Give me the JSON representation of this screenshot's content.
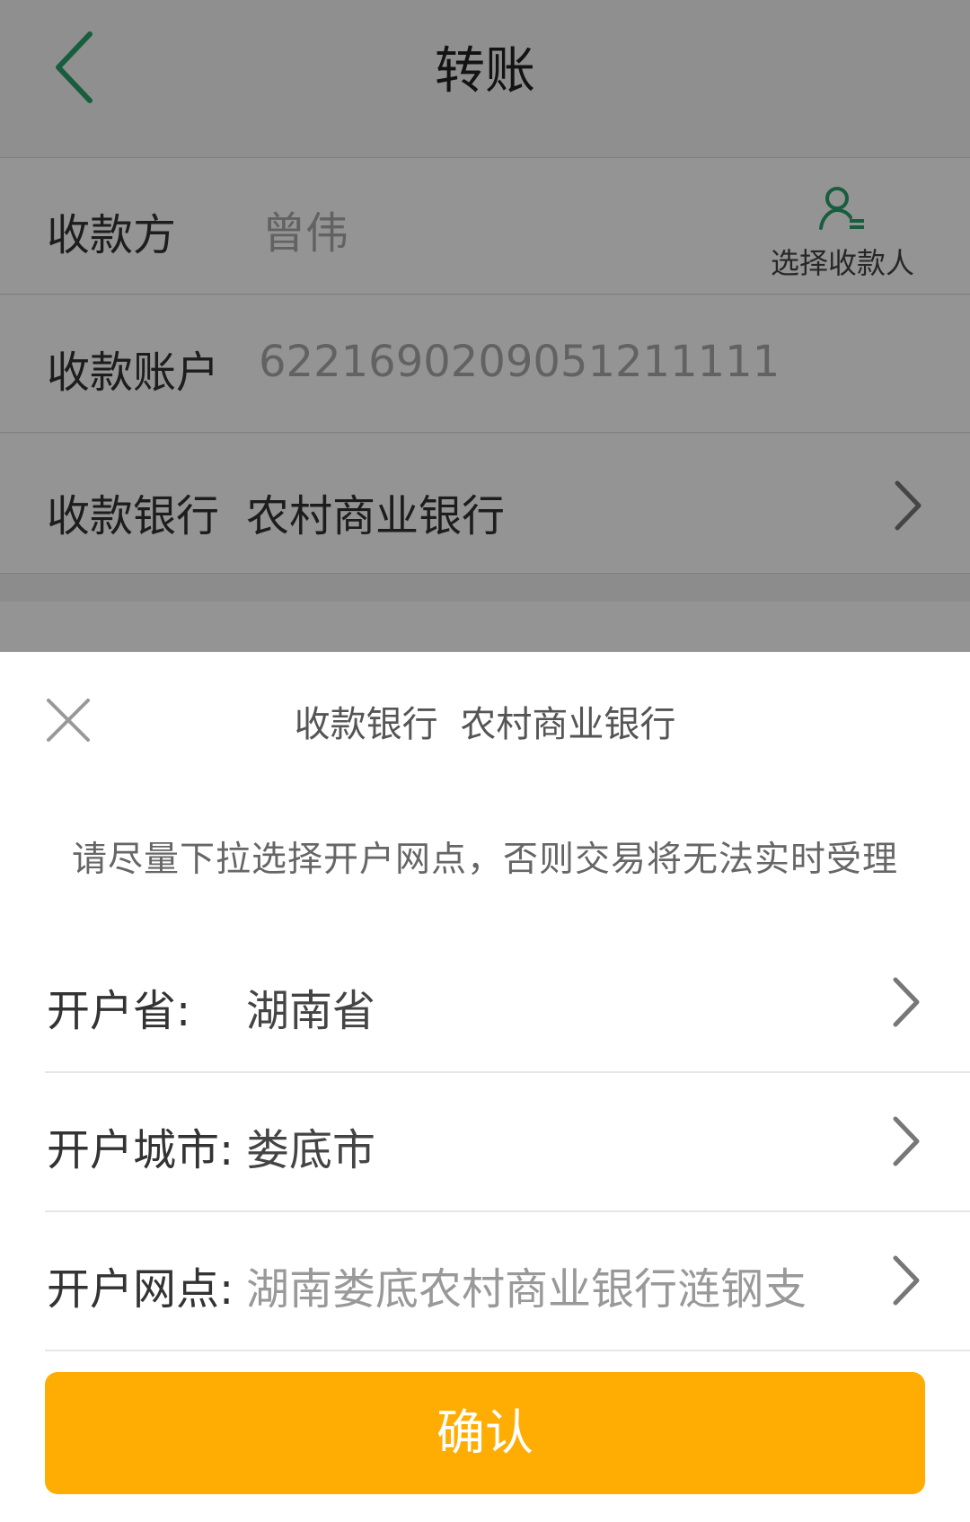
{
  "colors": {
    "accent_green": "#2aa36b",
    "confirm_orange": "#ffad03"
  },
  "header": {
    "back_icon": "chevron-left-icon",
    "title": "转账"
  },
  "form": {
    "payee_label": "收款方",
    "payee_value": "曾伟",
    "select_payee_label": "选择收款人",
    "select_payee_icon": "contact-list-icon",
    "account_label": "收款账户",
    "account_value": "6221690209051211111",
    "bank_label": "收款银行",
    "bank_value": "农村商业银行"
  },
  "sheet": {
    "close_icon": "close-icon",
    "title_label": "收款银行",
    "title_value": "农村商业银行",
    "notice": "请尽量下拉选择开户网点，否则交易将无法实时受理",
    "rows": [
      {
        "label": "开户省:",
        "value": "湖南省"
      },
      {
        "label": "开户城市:",
        "value": "娄底市"
      },
      {
        "label": "开户网点:",
        "value": "湖南娄底农村商业银行涟钢支"
      }
    ],
    "confirm_label": "确认"
  }
}
